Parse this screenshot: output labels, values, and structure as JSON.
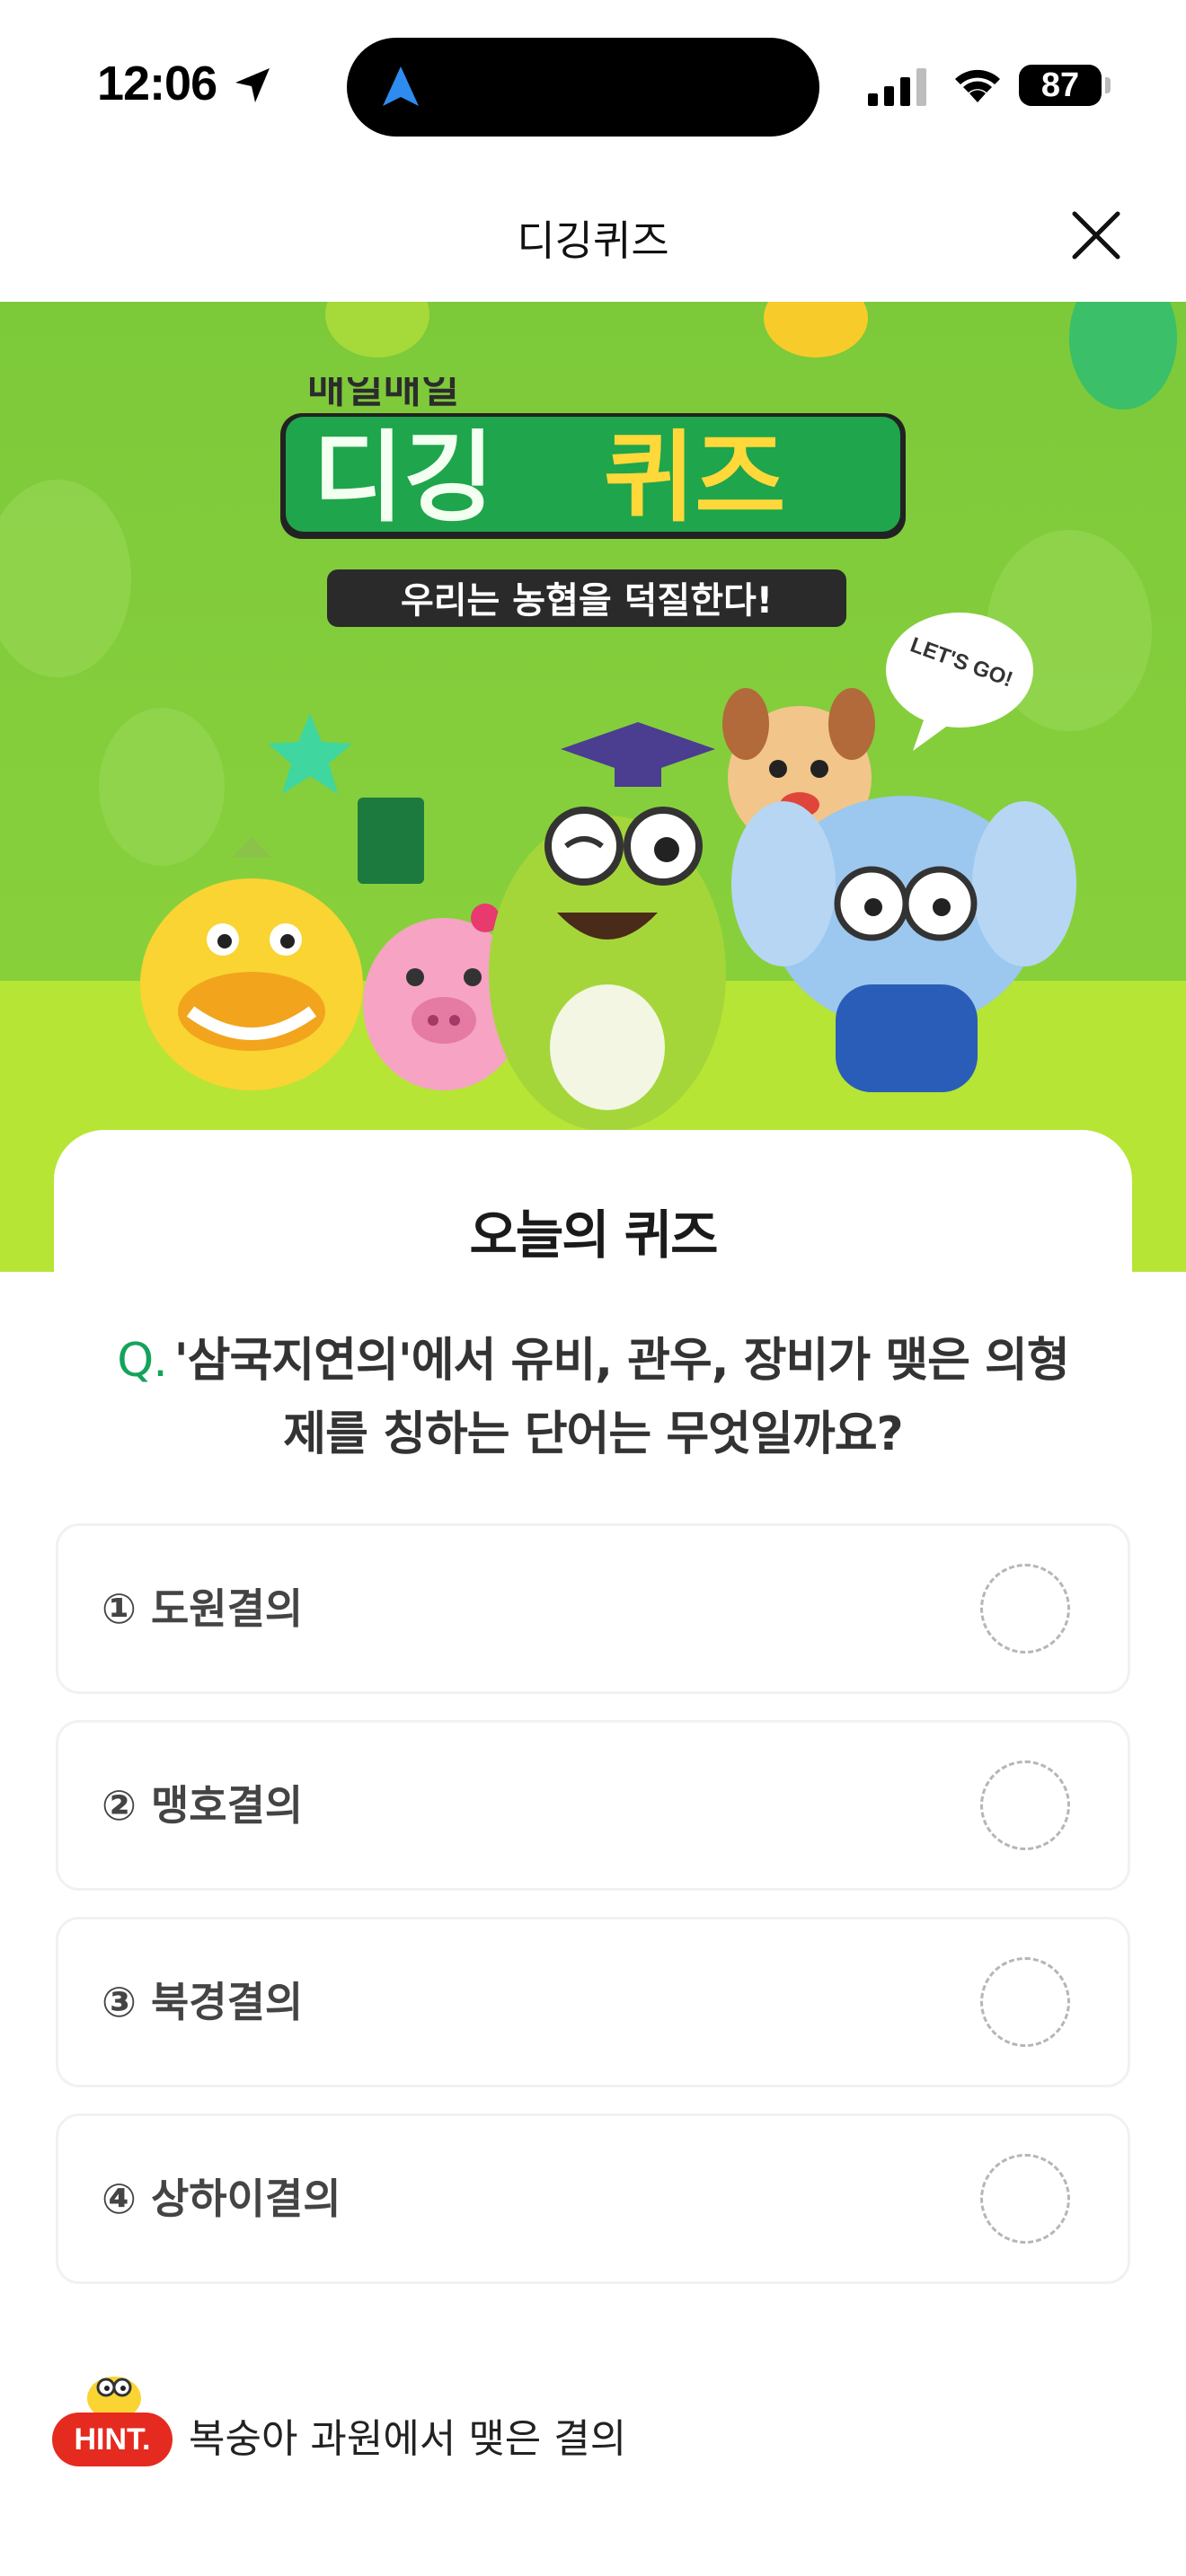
{
  "status_bar": {
    "time": "12:06",
    "battery": "87",
    "icons": [
      "location-arrow-icon",
      "navigation-icon",
      "signal-icon",
      "wifi-icon",
      "battery-icon"
    ]
  },
  "header": {
    "title": "디깅퀴즈",
    "close_icon": "close-icon"
  },
  "banner": {
    "top_text": "매일매일",
    "title_green": "디깅",
    "title_yellow": "퀴즈",
    "slogan": "우리는 농협을 덕질한다!",
    "speech_bubble": "LET'S GO!"
  },
  "quiz": {
    "section_label": "오늘의 퀴즈",
    "question_prefix": "Q.",
    "question": "'삼국지연의'에서 유비, 관우, 장비가 맺은 의형제를 칭하는 단어는 무엇일까요?",
    "options": [
      {
        "label": "① 도원결의"
      },
      {
        "label": "② 맹호결의"
      },
      {
        "label": "③ 북경결의"
      },
      {
        "label": "④ 상하이결의"
      }
    ]
  },
  "hint": {
    "badge": "HINT.",
    "text": "복숭아 과원에서 맺은 결의"
  },
  "colors": {
    "accent_green": "#14a35a",
    "banner_green": "#7cc93a",
    "hint_red": "#e52a1f"
  }
}
